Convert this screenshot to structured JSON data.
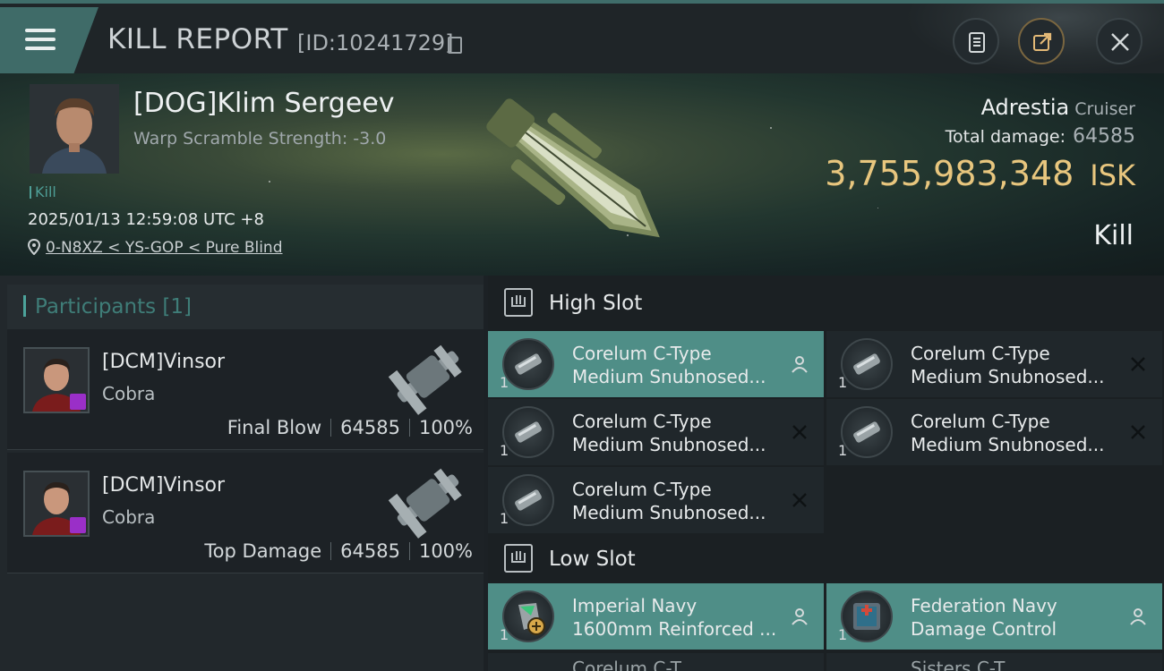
{
  "header": {
    "title": "KILL REPORT",
    "report_id": "[ID:10241729]"
  },
  "victim": {
    "name": "[DOG]Klim Sergeev",
    "warp_scramble": "Warp Scramble Strength: -3.0",
    "tag": "Kill",
    "datetime": "2025/01/13 12:59:08 UTC +8",
    "location": "0-N8XZ < YS-GOP < Pure Blind",
    "ship_name": "Adrestia",
    "ship_class": "Cruiser",
    "total_damage_label": "Total damage:",
    "total_damage": "64585",
    "isk_value": "3,755,983,348",
    "isk_unit": "ISK",
    "result": "Kill"
  },
  "participants": {
    "title": "Participants",
    "count": "[1]",
    "items": [
      {
        "name": "[DCM]Vinsor",
        "ship": "Cobra",
        "role": "Final Blow",
        "damage": "64585",
        "percent": "100%"
      },
      {
        "name": "[DCM]Vinsor",
        "ship": "Cobra",
        "role": "Top Damage",
        "damage": "64585",
        "percent": "100%"
      }
    ]
  },
  "slots": {
    "high": {
      "label": "High Slot",
      "modules": [
        {
          "line1": "Corelum C-Type",
          "line2": "Medium Snubnosed...",
          "qty": "1",
          "status": "dropped",
          "status_icon": "person-icon"
        },
        {
          "line1": "Corelum C-Type",
          "line2": "Medium Snubnosed...",
          "qty": "1",
          "status": "destroyed",
          "status_icon": "close-icon"
        },
        {
          "line1": "Corelum C-Type",
          "line2": "Medium Snubnosed...",
          "qty": "1",
          "status": "destroyed",
          "status_icon": "close-icon"
        },
        {
          "line1": "Corelum C-Type",
          "line2": "Medium Snubnosed...",
          "qty": "1",
          "status": "destroyed",
          "status_icon": "close-icon"
        },
        {
          "line1": "Corelum C-Type",
          "line2": "Medium Snubnosed...",
          "qty": "1",
          "status": "destroyed",
          "status_icon": "close-icon"
        }
      ]
    },
    "low": {
      "label": "Low Slot",
      "modules": [
        {
          "line1": "Imperial Navy",
          "line2": "1600mm Reinforced ...",
          "qty": "1",
          "status": "dropped",
          "status_icon": "person-icon"
        },
        {
          "line1": "Federation Navy",
          "line2": "Damage Control",
          "qty": "1",
          "status": "dropped",
          "status_icon": "person-icon"
        },
        {
          "line1": "Corelum C-T...",
          "line2": "",
          "qty": "",
          "status": "",
          "status_icon": ""
        },
        {
          "line1": "Sisters C-T...",
          "line2": "",
          "qty": "",
          "status": "",
          "status_icon": ""
        }
      ]
    }
  },
  "colors": {
    "accent": "#4f8e87",
    "isk_gold": "#e8c67e",
    "background": "#1c2125"
  }
}
